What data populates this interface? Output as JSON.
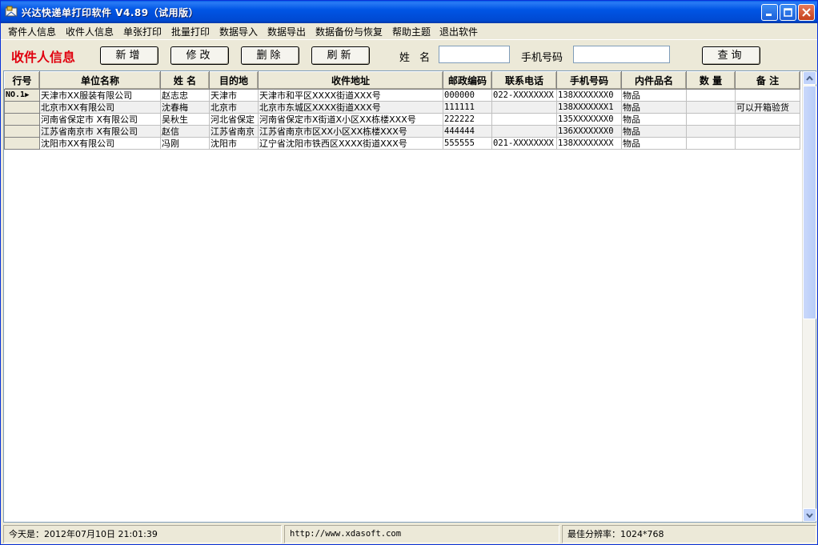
{
  "window": {
    "title": "兴达快递单打印软件 V4.89（试用版）"
  },
  "menu": [
    "寄件人信息",
    "收件人信息",
    "单张打印",
    "批量打印",
    "数据导入",
    "数据导出",
    "数据备份与恢复",
    "帮助主题",
    "退出软件"
  ],
  "toolbar": {
    "section_title": "收件人信息",
    "add_label": "新增",
    "edit_label": "修改",
    "delete_label": "删除",
    "refresh_label": "刷新",
    "name_label": "姓 名",
    "name_value": "",
    "phone_label": "手机号码",
    "phone_value": "",
    "query_label": "查询"
  },
  "grid": {
    "columns": [
      "行号",
      "单位名称",
      "姓 名",
      "目的地",
      "收件地址",
      "邮政编码",
      "联系电话",
      "手机号码",
      "内件品名",
      "数 量",
      "备 注"
    ],
    "current_row_label": "NO.1",
    "rows": [
      {
        "company": "天津市XX服装有限公司",
        "name": "赵志忠",
        "dest": "天津市",
        "address": "天津市和平区XXXX街道XXX号",
        "zip": "000000",
        "tel": "022-XXXXXXXX",
        "mobile": "138XXXXXXX0",
        "item": "物品",
        "qty": "",
        "note": ""
      },
      {
        "company": "北京市XX有限公司",
        "name": "沈春梅",
        "dest": "北京市",
        "address": "北京市东城区XXXX街道XXX号",
        "zip": "111111",
        "tel": "",
        "mobile": "138XXXXXXX1",
        "item": "物品",
        "qty": "",
        "note": "可以开箱验货"
      },
      {
        "company": "河南省保定市 X有限公司",
        "name": "吴秋生",
        "dest": "河北省保定",
        "address": "河南省保定市X街道X小区XX栋楼XXX号",
        "zip": "222222",
        "tel": "",
        "mobile": "135XXXXXXX0",
        "item": "物品",
        "qty": "",
        "note": ""
      },
      {
        "company": "江苏省南京市 X有限公司",
        "name": "赵信",
        "dest": "江苏省南京",
        "address": "江苏省南京市区XX小区XX栋楼XXX号",
        "zip": "444444",
        "tel": "",
        "mobile": "136XXXXXXX0",
        "item": "物品",
        "qty": "",
        "note": ""
      },
      {
        "company": "沈阳市XX有限公司",
        "name": "冯刚",
        "dest": "沈阳市",
        "address": "辽宁省沈阳市铁西区XXXX街道XXX号",
        "zip": "555555",
        "tel": "021-XXXXXXXX",
        "mobile": "138XXXXXXXX",
        "item": "物品",
        "qty": "",
        "note": ""
      }
    ]
  },
  "status": {
    "date": "今天是：2012年07月10日  21:01:39",
    "url": "http://www.xdasoft.com",
    "resolution": "最佳分辨率：1024*768"
  },
  "colors": {
    "accent_red": "#e0000e",
    "titlebar_blue": "#0055e5"
  }
}
